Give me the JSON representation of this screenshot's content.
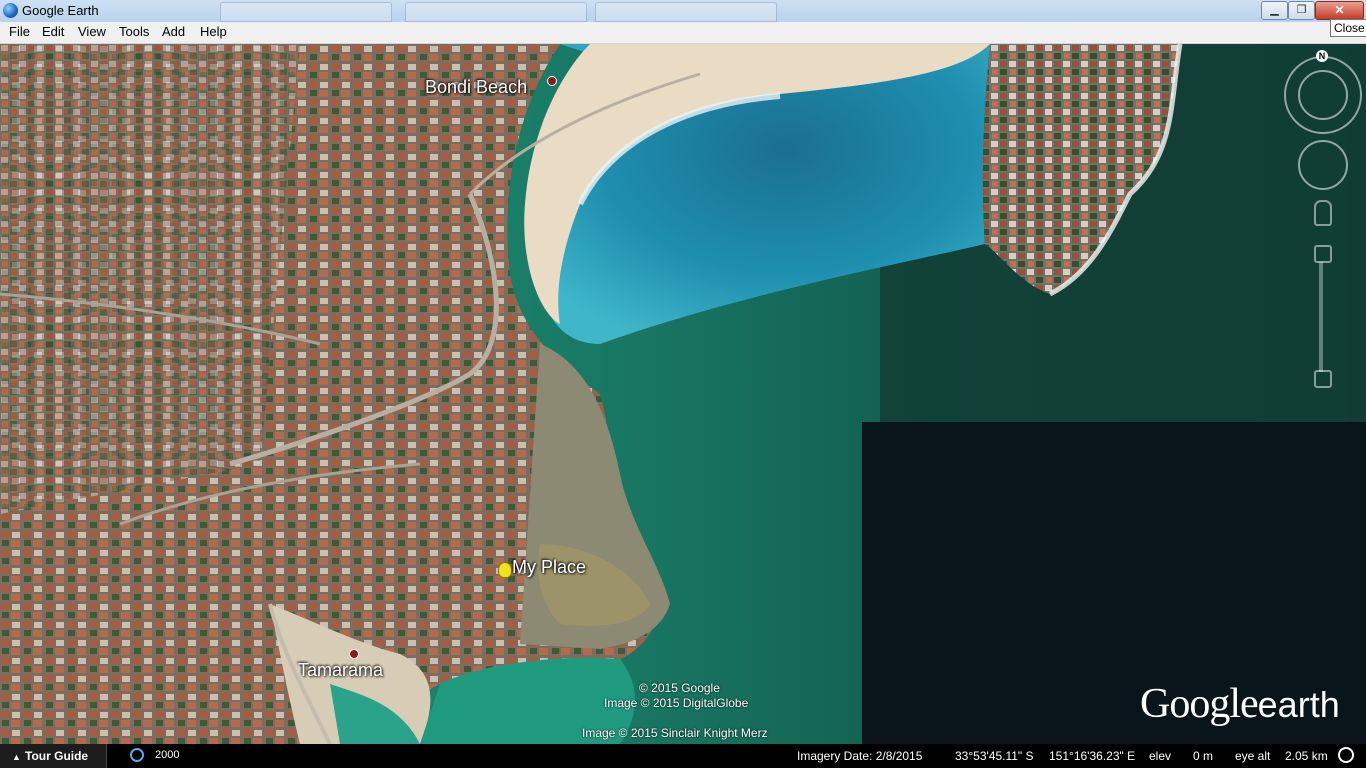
{
  "window": {
    "title": "Google Earth",
    "close_tooltip": "Close",
    "min_glyph": "▁",
    "max_glyph": "❐",
    "close_glyph": "✕"
  },
  "menu": [
    "File",
    "Edit",
    "View",
    "Tools",
    "Add",
    "Help"
  ],
  "map": {
    "places": {
      "bondi": "Bondi Beach",
      "my_place": "My Place",
      "tamarama": "Tamarama"
    },
    "copyright": {
      "line1": "© 2015 Google",
      "line2": "Image © 2015 DigitalGlobe",
      "line3": "Image © 2015 Sinclair Knight Merz"
    },
    "logo": {
      "brand": "Google",
      "product": "earth"
    },
    "nav": {
      "north": "N"
    }
  },
  "status": {
    "tour_label": "Tour Guide",
    "history_year": "2000",
    "imagery_date": "Imagery Date: 2/8/2015",
    "lat": "33°53'45.11\" S",
    "lon": "151°16'36.23\" E",
    "elev_label": "elev",
    "elev_value": "0 m",
    "eye_alt_label": "eye alt",
    "eye_alt_value": "2.05 km"
  },
  "colors": {
    "ocean_deep": "#0d2a2e",
    "ocean_green": "#1d8a73",
    "bay_blue": "#1f86a8",
    "sand": "#eadcc4",
    "suburb": "#8a7a68",
    "shadow": "#0a1218"
  },
  "icons": [
    "google-earth-app-icon",
    "map-pin-icon",
    "placemark-dot-icon",
    "play-triangle-icon",
    "history-clock-icon",
    "streaming-status-icon",
    "compass-ring-icon"
  ]
}
